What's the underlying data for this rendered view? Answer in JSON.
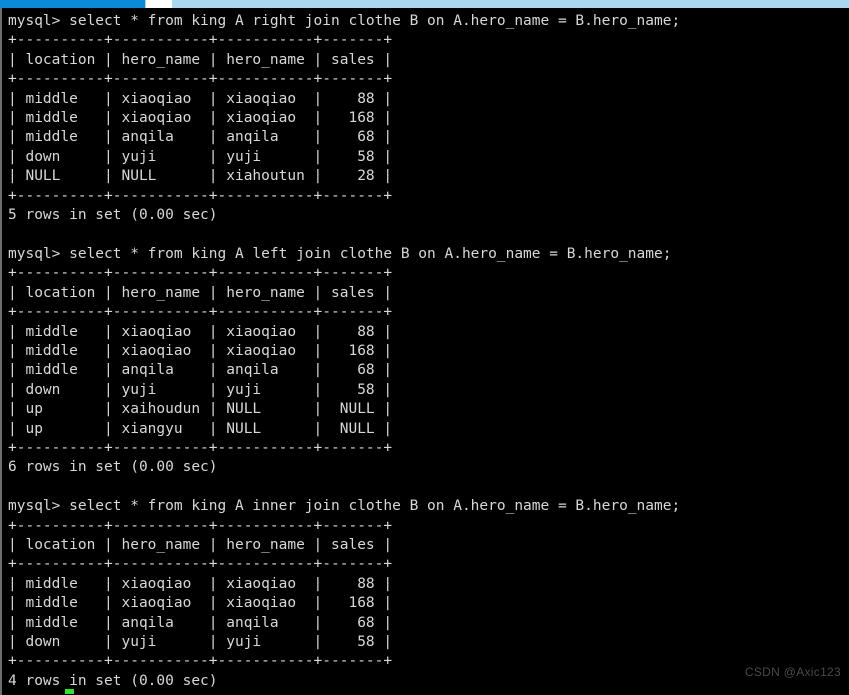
{
  "window": {
    "title": "mysql-client-terminal",
    "scrollbar": {
      "name": "horizontal-scrollbar",
      "track_color": "#aad7ef",
      "filled_color": "#0b8ad8",
      "thumb_color": "#ffffff"
    },
    "background_color": "#000000",
    "foreground_color": "#d8d8d8",
    "cursor_color": "#2fe02f"
  },
  "watermark": {
    "text": "CSDN @Axic123"
  },
  "prompt": "mysql> ",
  "table_columns": [
    "location",
    "hero_name",
    "hero_name",
    "sales"
  ],
  "separator_line": "+----------+-----------+-----------+-------+",
  "blocks": [
    {
      "id": "right-join-block",
      "command": "mysql> select * from king A right join clothe B on A.hero_name = B.hero_name;",
      "query": "select * from king A right join clothe B on A.hero_name = B.hero_name;",
      "join_type": "right join",
      "header_line": "| location | hero_name | hero_name | sales |",
      "rows": [
        {
          "location": "middle",
          "hero_name_a": "xiaoqiao",
          "hero_name_b": "xiaoqiao",
          "sales": "88"
        },
        {
          "location": "middle",
          "hero_name_a": "xiaoqiao",
          "hero_name_b": "xiaoqiao",
          "sales": "168"
        },
        {
          "location": "middle",
          "hero_name_a": "anqila",
          "hero_name_b": "anqila",
          "sales": "68"
        },
        {
          "location": "down",
          "hero_name_a": "yuji",
          "hero_name_b": "yuji",
          "sales": "58"
        },
        {
          "location": "NULL",
          "hero_name_a": "NULL",
          "hero_name_b": "xiahoutun",
          "sales": "28"
        }
      ],
      "row_lines": [
        "| middle   | xiaoqiao  | xiaoqiao  |    88 |",
        "| middle   | xiaoqiao  | xiaoqiao  |   168 |",
        "| middle   | anqila    | anqila    |    68 |",
        "| down     | yuji      | yuji      |    58 |",
        "| NULL     | NULL      | xiahoutun |    28 |"
      ],
      "status": "5 rows in set (0.00 sec)",
      "row_count": 5,
      "elapsed": "0.00 sec"
    },
    {
      "id": "left-join-block",
      "command": "mysql> select * from king A left join clothe B on A.hero_name = B.hero_name;",
      "query": "select * from king A left join clothe B on A.hero_name = B.hero_name;",
      "join_type": "left join",
      "header_line": "| location | hero_name | hero_name | sales |",
      "rows": [
        {
          "location": "middle",
          "hero_name_a": "xiaoqiao",
          "hero_name_b": "xiaoqiao",
          "sales": "88"
        },
        {
          "location": "middle",
          "hero_name_a": "xiaoqiao",
          "hero_name_b": "xiaoqiao",
          "sales": "168"
        },
        {
          "location": "middle",
          "hero_name_a": "anqila",
          "hero_name_b": "anqila",
          "sales": "68"
        },
        {
          "location": "down",
          "hero_name_a": "yuji",
          "hero_name_b": "yuji",
          "sales": "58"
        },
        {
          "location": "up",
          "hero_name_a": "xaihoudun",
          "hero_name_b": "NULL",
          "sales": "NULL"
        },
        {
          "location": "up",
          "hero_name_a": "xiangyu",
          "hero_name_b": "NULL",
          "sales": "NULL"
        }
      ],
      "row_lines": [
        "| middle   | xiaoqiao  | xiaoqiao  |    88 |",
        "| middle   | xiaoqiao  | xiaoqiao  |   168 |",
        "| middle   | anqila    | anqila    |    68 |",
        "| down     | yuji      | yuji      |    58 |",
        "| up       | xaihoudun | NULL      |  NULL |",
        "| up       | xiangyu   | NULL      |  NULL |"
      ],
      "status": "6 rows in set (0.00 sec)",
      "row_count": 6,
      "elapsed": "0.00 sec"
    },
    {
      "id": "inner-join-block",
      "command": "mysql> select * from king A inner join clothe B on A.hero_name = B.hero_name;",
      "query": "select * from king A inner join clothe B on A.hero_name = B.hero_name;",
      "join_type": "inner join",
      "header_line": "| location | hero_name | hero_name | sales |",
      "rows": [
        {
          "location": "middle",
          "hero_name_a": "xiaoqiao",
          "hero_name_b": "xiaoqiao",
          "sales": "88"
        },
        {
          "location": "middle",
          "hero_name_a": "xiaoqiao",
          "hero_name_b": "xiaoqiao",
          "sales": "168"
        },
        {
          "location": "middle",
          "hero_name_a": "anqila",
          "hero_name_b": "anqila",
          "sales": "68"
        },
        {
          "location": "down",
          "hero_name_a": "yuji",
          "hero_name_b": "yuji",
          "sales": "58"
        }
      ],
      "row_lines": [
        "| middle   | xiaoqiao  | xiaoqiao  |    88 |",
        "| middle   | xiaoqiao  | xiaoqiao  |   168 |",
        "| middle   | anqila    | anqila    |    68 |",
        "| down     | yuji      | yuji      |    58 |"
      ],
      "status": "4 rows in set (0.00 sec)",
      "row_count": 4,
      "elapsed": "0.00 sec"
    }
  ],
  "console_text": "mysql> select * from king A right join clothe B on A.hero_name = B.hero_name;\n+----------+-----------+-----------+-------+\n| location | hero_name | hero_name | sales |\n+----------+-----------+-----------+-------+\n| middle   | xiaoqiao  | xiaoqiao  |    88 |\n| middle   | xiaoqiao  | xiaoqiao  |   168 |\n| middle   | anqila    | anqila    |    68 |\n| down     | yuji      | yuji      |    58 |\n| NULL     | NULL      | xiahoutun |    28 |\n+----------+-----------+-----------+-------+\n5 rows in set (0.00 sec)\n\nmysql> select * from king A left join clothe B on A.hero_name = B.hero_name;\n+----------+-----------+-----------+-------+\n| location | hero_name | hero_name | sales |\n+----------+-----------+-----------+-------+\n| middle   | xiaoqiao  | xiaoqiao  |    88 |\n| middle   | xiaoqiao  | xiaoqiao  |   168 |\n| middle   | anqila    | anqila    |    68 |\n| down     | yuji      | yuji      |    58 |\n| up       | xaihoudun | NULL      |  NULL |\n| up       | xiangyu   | NULL      |  NULL |\n+----------+-----------+-----------+-------+\n6 rows in set (0.00 sec)\n\nmysql> select * from king A inner join clothe B on A.hero_name = B.hero_name;\n+----------+-----------+-----------+-------+\n| location | hero_name | hero_name | sales |\n+----------+-----------+-----------+-------+\n| middle   | xiaoqiao  | xiaoqiao  |    88 |\n| middle   | xiaoqiao  | xiaoqiao  |   168 |\n| middle   | anqila    | anqila    |    68 |\n| down     | yuji      | yuji      |    58 |\n+----------+-----------+-----------+-------+\n4 rows in set (0.00 sec)"
}
